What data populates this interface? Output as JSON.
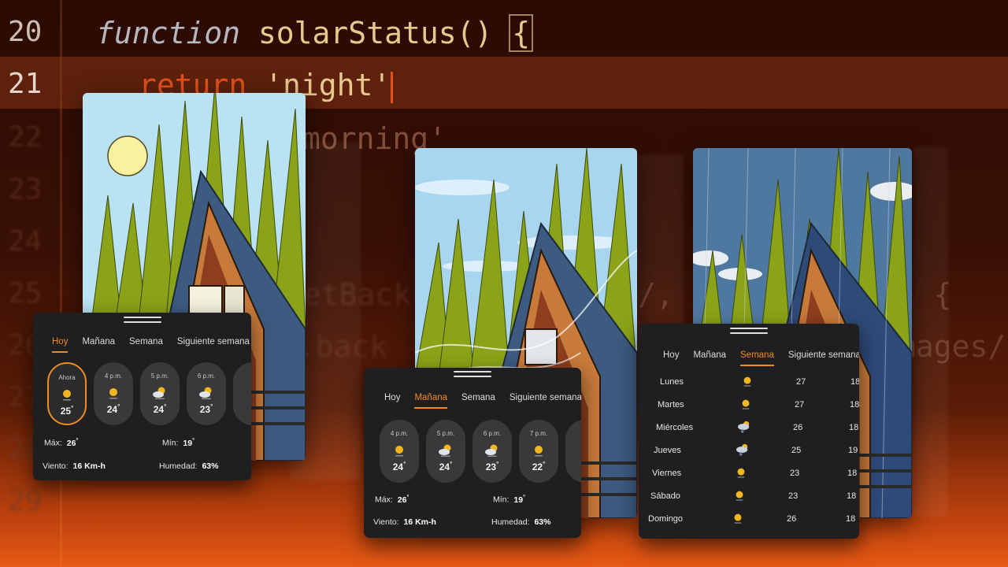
{
  "code": {
    "lines": [
      {
        "num": "20",
        "text": "function solarStatus() {"
      },
      {
        "num": "21",
        "text": "return 'night';"
      },
      {
        "num": "22",
        "text": "morning'"
      },
      {
        "num": "23",
        "text": ""
      },
      {
        "num": "24",
        "text": ""
      },
      {
        "num": "25",
        "text": "setBack"
      },
      {
        "num": "26",
        "text": "le.back"
      },
      {
        "num": "27",
        "text": ""
      },
      {
        "num": "28",
        "text": ""
      },
      {
        "num": "29",
        "text": ""
      }
    ],
    "kw_function": "function",
    "fn_name": "solarStatus()",
    "brace": "{",
    "ret_kw": "return",
    "ret_str": "'night'",
    "fragment_mid1": "/, s",
    "fragment_mid2": ") {",
    "fragment_mid3": "ge",
    "fragment_right": "mages/"
  },
  "icons": {
    "sunny": "sun-icon",
    "partly": "partly-cloudy-icon",
    "storm": "storm-cloud-icon"
  },
  "colors": {
    "accent": "#f08a24",
    "panel": "#1f1f21",
    "pill": "#39393c"
  },
  "panel1": {
    "tabs": [
      "Hoy",
      "Mañana",
      "Semana",
      "Siguiente semana"
    ],
    "active_tab": "Hoy",
    "hours": [
      {
        "time": "Ahora",
        "icon": "sun-icon",
        "temp": "25",
        "active": true
      },
      {
        "time": "4 p.m.",
        "icon": "sun-icon",
        "temp": "24"
      },
      {
        "time": "5 p.m.",
        "icon": "partly-cloudy-icon",
        "temp": "24"
      },
      {
        "time": "6 p.m.",
        "icon": "partly-cloudy-icon",
        "temp": "23"
      }
    ],
    "max_label": "Máx:",
    "max": "26",
    "min_label": "Mín:",
    "min": "19",
    "wind_label": "Viento:",
    "wind": "16 Km-h",
    "humidity_label": "Humedad:",
    "humidity": "63%"
  },
  "panel2": {
    "tabs": [
      "Hoy",
      "Mañana",
      "Semana",
      "Siguiente semana"
    ],
    "active_tab": "Mañana",
    "hours": [
      {
        "time": "4 p.m.",
        "icon": "sun-icon",
        "temp": "24"
      },
      {
        "time": "5 p.m.",
        "icon": "partly-cloudy-icon",
        "temp": "24"
      },
      {
        "time": "6 p.m.",
        "icon": "partly-cloudy-icon",
        "temp": "23"
      },
      {
        "time": "7 p.m.",
        "icon": "sun-icon",
        "temp": "22"
      }
    ],
    "max_label": "Máx:",
    "max": "26",
    "min_label": "Mín:",
    "min": "19",
    "wind_label": "Viento:",
    "wind": "16 Km-h",
    "humidity_label": "Humedad:",
    "humidity": "63%"
  },
  "panel3": {
    "tabs": [
      "Hoy",
      "Mañana",
      "Semana",
      "Siguiente semana"
    ],
    "active_tab": "Semana",
    "days": [
      {
        "day": "Lunes",
        "icon": "sun-icon",
        "max": "27",
        "min": "18"
      },
      {
        "day": "Martes",
        "icon": "sun-icon",
        "max": "27",
        "min": "18"
      },
      {
        "day": "Miércoles",
        "icon": "storm-cloud-icon",
        "max": "26",
        "min": "18"
      },
      {
        "day": "Jueves",
        "icon": "storm-cloud-icon",
        "max": "25",
        "min": "19"
      },
      {
        "day": "Viernes",
        "icon": "sun-icon",
        "max": "23",
        "min": "18"
      },
      {
        "day": "Sábado",
        "icon": "sun-icon",
        "max": "23",
        "min": "18"
      },
      {
        "day": "Domingo",
        "icon": "sun-icon",
        "max": "26",
        "min": "18"
      }
    ]
  }
}
